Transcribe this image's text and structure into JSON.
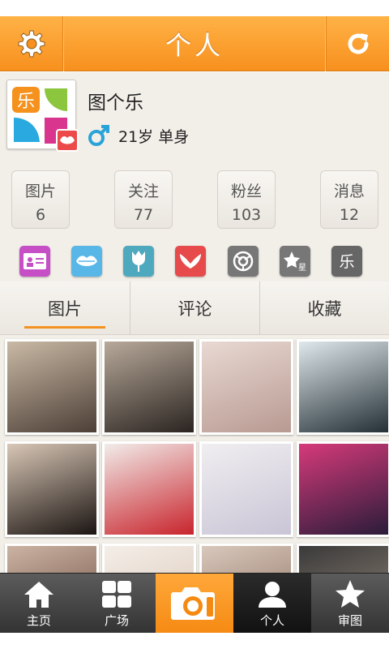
{
  "header": {
    "title": "个人",
    "settings_icon": "gear-icon",
    "refresh_icon": "refresh-icon"
  },
  "profile": {
    "name": "图个乐",
    "age_status": "21岁 单身",
    "avatar_icon": "le-logo-icon",
    "gender_icon": "male-symbol-icon"
  },
  "stats": [
    {
      "label": "图片",
      "value": "6"
    },
    {
      "label": "关注",
      "value": "77"
    },
    {
      "label": "粉丝",
      "value": "103"
    },
    {
      "label": "消息",
      "value": "12"
    }
  ],
  "tools": [
    {
      "icon": "contact-card-icon",
      "color": "#c64fc6"
    },
    {
      "icon": "lips-icon",
      "color": "#59b7e8"
    },
    {
      "icon": "tulip-icon",
      "color": "#4fa9be"
    },
    {
      "icon": "wings-icon",
      "color": "#e64a4a"
    },
    {
      "icon": "camera-lens-icon",
      "color": "#777777"
    },
    {
      "icon": "star-icon",
      "color": "#777777"
    },
    {
      "icon": "le-icon",
      "color": "#666666"
    }
  ],
  "tabs": [
    {
      "label": "图片",
      "active": true
    },
    {
      "label": "评论",
      "active": false
    },
    {
      "label": "收藏",
      "active": false
    }
  ],
  "photos": [
    {
      "icon": "photo-thumbnail",
      "colors": [
        "#c9b9a5",
        "#4c3f36"
      ]
    },
    {
      "icon": "photo-thumbnail",
      "colors": [
        "#b8a99a",
        "#2a2420"
      ]
    },
    {
      "icon": "photo-thumbnail",
      "colors": [
        "#e8d9d2",
        "#b89a92"
      ]
    },
    {
      "icon": "photo-thumbnail",
      "colors": [
        "#dfe8ec",
        "#243036"
      ]
    },
    {
      "icon": "photo-thumbnail",
      "colors": [
        "#d9c7b6",
        "#1b1512"
      ]
    },
    {
      "icon": "photo-thumbnail",
      "colors": [
        "#f2ecea",
        "#c8242c"
      ]
    },
    {
      "icon": "photo-thumbnail",
      "colors": [
        "#f0eef0",
        "#c9c5d6"
      ]
    },
    {
      "icon": "photo-thumbnail",
      "colors": [
        "#d63a7a",
        "#2a1c3a"
      ]
    },
    {
      "icon": "photo-thumbnail",
      "colors": [
        "#cbb3a3",
        "#6a4a3e"
      ]
    },
    {
      "icon": "photo-thumbnail",
      "colors": [
        "#f4eee8",
        "#d8c3b4"
      ]
    },
    {
      "icon": "photo-thumbnail",
      "colors": [
        "#d8c8bc",
        "#8a6c5c"
      ]
    },
    {
      "icon": "photo-thumbnail",
      "colors": [
        "#3a3a3a",
        "#9a8a7c"
      ]
    }
  ],
  "nav": [
    {
      "label": "主页",
      "icon": "home-icon"
    },
    {
      "label": "广场",
      "icon": "grid-icon"
    },
    {
      "label": "",
      "icon": "camera-icon"
    },
    {
      "label": "个人",
      "icon": "person-icon"
    },
    {
      "label": "审图",
      "icon": "star-icon"
    }
  ],
  "colors": {
    "accent": "#f7901e",
    "tab_indicator": "#f39221"
  }
}
